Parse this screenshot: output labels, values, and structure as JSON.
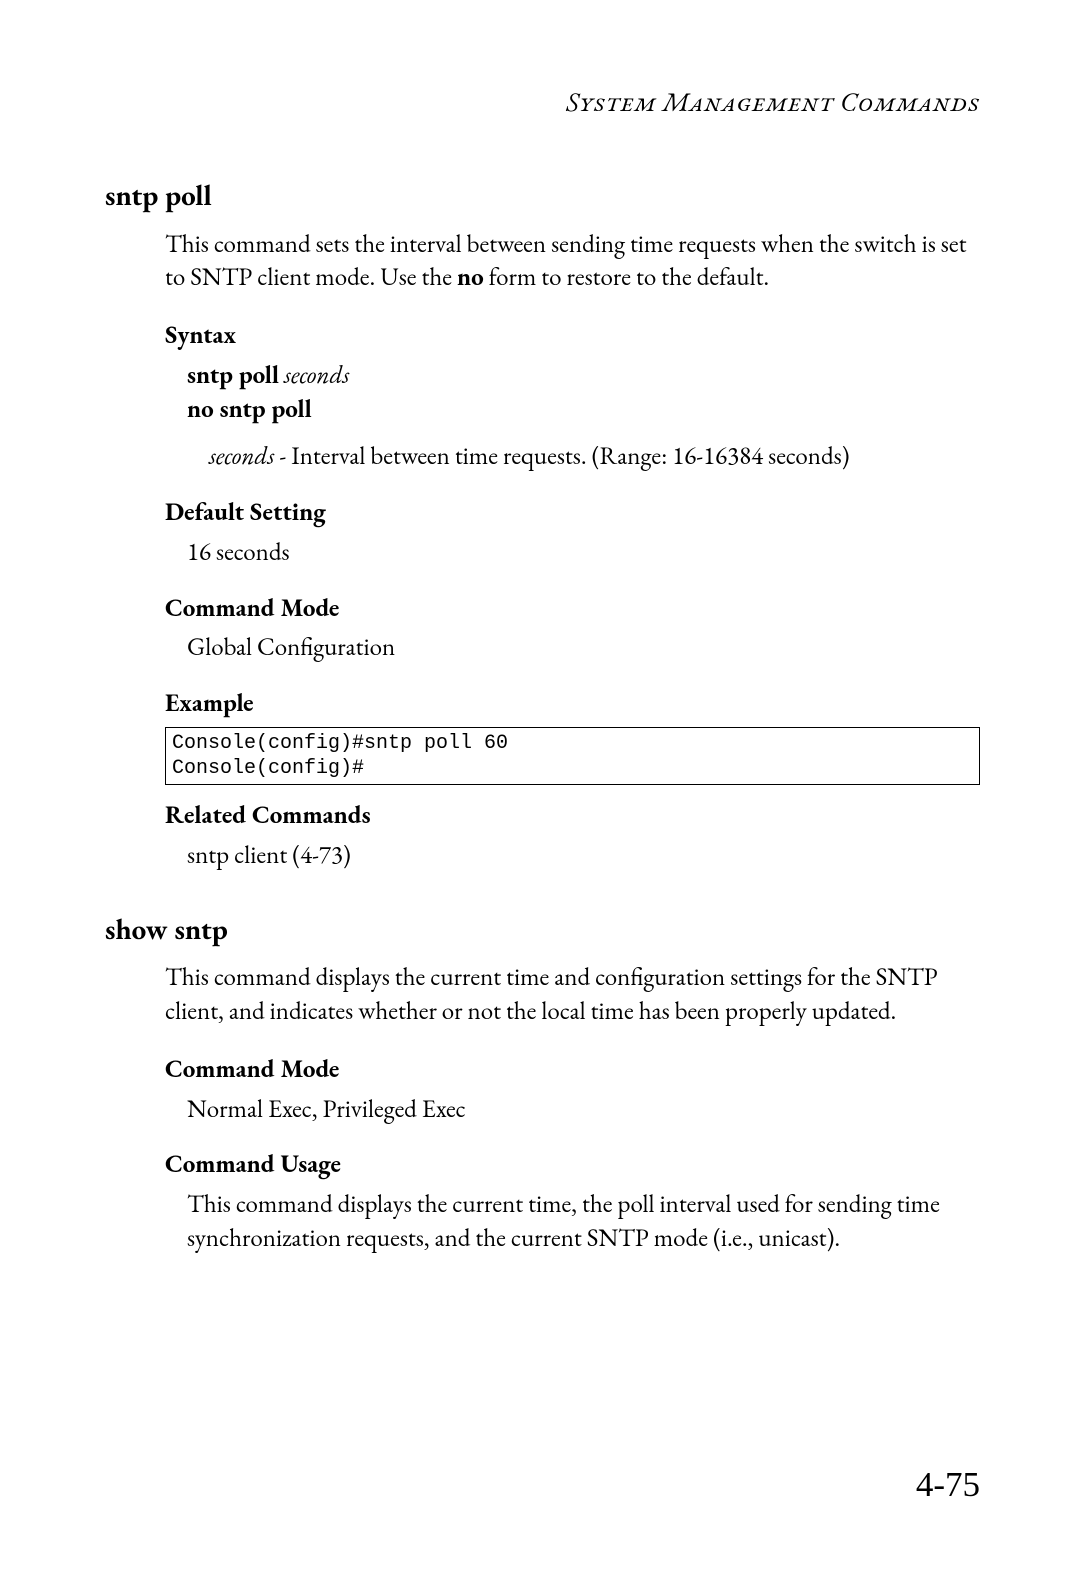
{
  "running_header": "System Management Commands",
  "page_number": "4-75",
  "sections": [
    {
      "title": "sntp poll",
      "intro_pre": "This command sets the interval between sending time requests when the switch is set to SNTP client mode. Use the ",
      "intro_bold": "no",
      "intro_post": " form to restore to the default.",
      "subs": {
        "syntax_label": "Syntax",
        "syntax_cmd_bold": "sntp poll",
        "syntax_cmd_italic": " seconds",
        "syntax_no": "no sntp poll",
        "param_italic": "seconds",
        "param_desc": " - Interval between time requests. (Range: 16-16384 seconds)",
        "default_label": "Default Setting",
        "default_value": "16 seconds",
        "mode_label": "Command Mode",
        "mode_value": "Global Configuration",
        "example_label": "Example",
        "example_code": "Console(config)#sntp poll 60\nConsole(config)#",
        "related_label": "Related Commands",
        "related_value": "sntp client (4-73)"
      }
    },
    {
      "title": "show sntp",
      "intro": "This command displays the current time and configuration settings for the SNTP client, and indicates whether or not the local time has been properly updated.",
      "subs": {
        "mode_label": "Command Mode",
        "mode_value": "Normal Exec, Privileged Exec",
        "usage_label": "Command Usage",
        "usage_value": "This command displays the current time, the poll interval used for sending time synchronization requests, and the current SNTP mode (i.e., unicast)."
      }
    }
  ]
}
